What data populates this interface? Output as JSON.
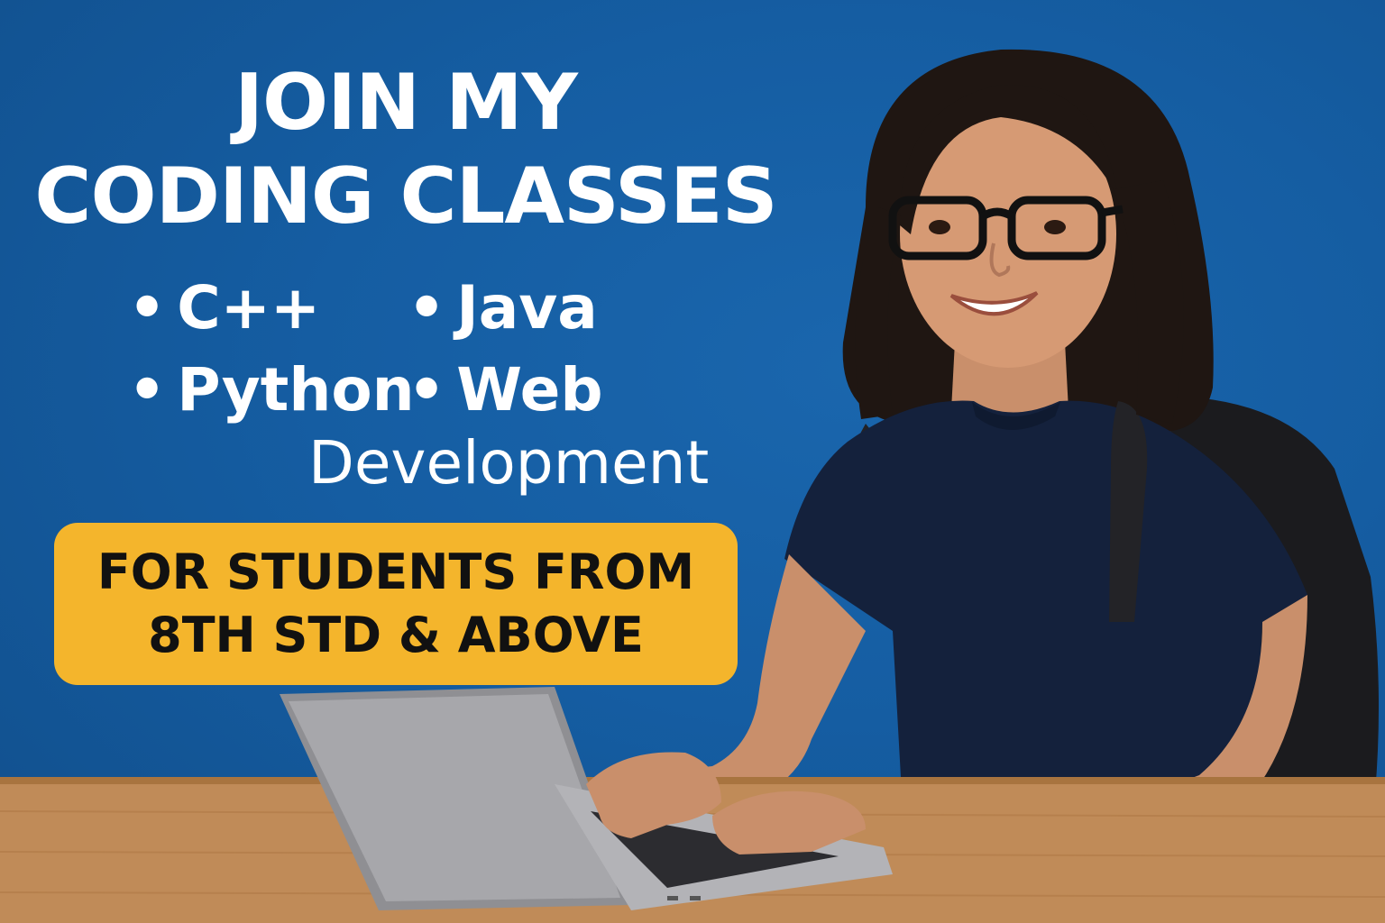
{
  "headline": {
    "line1": "JOIN MY",
    "line2": "CODING CLASSES"
  },
  "courses": [
    {
      "bullet": "•",
      "label": "C++"
    },
    {
      "bullet": "•",
      "label": "Java"
    },
    {
      "bullet": "•",
      "label": "Python"
    },
    {
      "bullet": "•",
      "label": "Web",
      "label_line2": "Development"
    }
  ],
  "badge": {
    "line1": "FOR STUDENTS FROM",
    "line2": "8TH STD & ABOVE"
  },
  "colors": {
    "background": "#14599c",
    "badge": "#f4b52c",
    "headline_text": "#ffffff",
    "badge_text": "#111111"
  },
  "icons": [
    "student-illustration",
    "laptop-icon",
    "backpack-icon",
    "glasses-icon"
  ]
}
